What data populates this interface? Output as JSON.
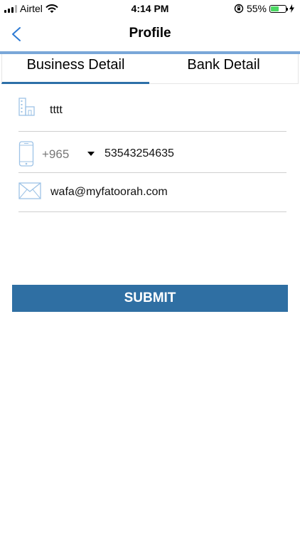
{
  "status_bar": {
    "carrier": "Airtel",
    "time": "4:14 PM",
    "battery_percent": "55%",
    "battery_level": 0.55
  },
  "nav": {
    "title": "Profile",
    "back_icon": "chevron-left-icon"
  },
  "tabs": [
    {
      "label": "Business Detail",
      "active": true
    },
    {
      "label": "Bank Detail",
      "active": false
    }
  ],
  "form": {
    "business_name": {
      "icon": "building-icon",
      "value": "tttt"
    },
    "phone": {
      "icon": "mobile-phone-icon",
      "country_code": "+965",
      "value": "53543254635"
    },
    "email": {
      "icon": "envelope-icon",
      "value": "wafa@myfatoorah.com"
    }
  },
  "submit": {
    "label": "SUBMIT"
  },
  "colors": {
    "accent": "#2f6fa3",
    "nav_rule": "#7aa7d8",
    "icon": "#9ec3e6",
    "battery": "#4cd964"
  }
}
